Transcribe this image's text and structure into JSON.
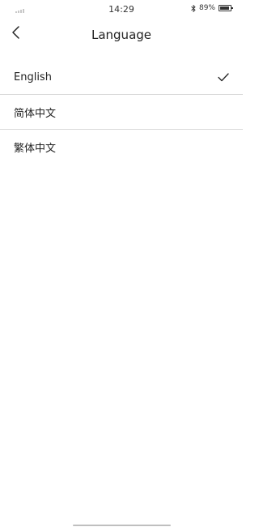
{
  "status_bar": {
    "time": "14:29",
    "battery_percent": "89%",
    "battery_level": 0.89,
    "icons": [
      "signal-icon",
      "bluetooth-icon",
      "battery-icon"
    ]
  },
  "nav": {
    "title": "Language",
    "back_icon": "chevron-left-icon"
  },
  "languages": [
    {
      "label": "English",
      "selected": true
    },
    {
      "label": "简体中文",
      "selected": false
    },
    {
      "label": "繁体中文",
      "selected": false
    }
  ],
  "colors": {
    "text": "#222222",
    "divider": "#d9d9d9",
    "home_indicator": "#bfbfbf"
  }
}
